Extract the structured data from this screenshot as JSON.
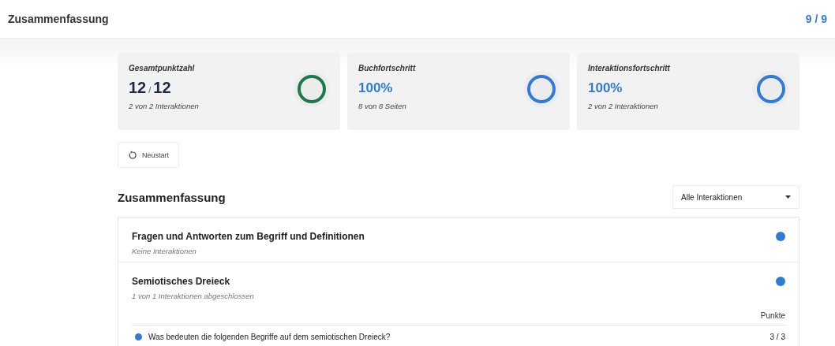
{
  "header": {
    "title": "Zusammenfassung",
    "page_counter": "9 / 9"
  },
  "cards": [
    {
      "kind": "score",
      "title": "Gesamtpunktzahl",
      "value": "12",
      "separator": "/",
      "max": "12",
      "caption": "2 von 2 Interaktionen",
      "level": 1,
      "color": "#1a7a4c"
    },
    {
      "kind": "percent",
      "title": "Buchfortschritt",
      "value": "100%",
      "caption": "8 von 8 Seiten",
      "level": 1,
      "color": "#2f7bd6"
    },
    {
      "kind": "percent",
      "title": "Interaktionsfortschritt",
      "value": "100%",
      "caption": "2 von 2 Interaktionen",
      "level": 1,
      "color": "#2f7bd6"
    }
  ],
  "restart_button": "Neustart",
  "summary": {
    "heading": "Zusammenfassung",
    "filter": "Alle Interaktionen",
    "chapters": [
      {
        "title": "Fragen und Antworten zum Begriff und Definitionen",
        "subtitle": "Keine Interaktionen"
      },
      {
        "title": "Semiotisches Dreieck",
        "subtitle": "1 von 1 Interaktionen abgeschlossen",
        "points_heading": "Punkte",
        "interactions": [
          {
            "question": "Was bedeuten die folgenden Begriffe auf dem semiotischen Dreieck?",
            "score": "3 / 3"
          }
        ]
      }
    ]
  }
}
